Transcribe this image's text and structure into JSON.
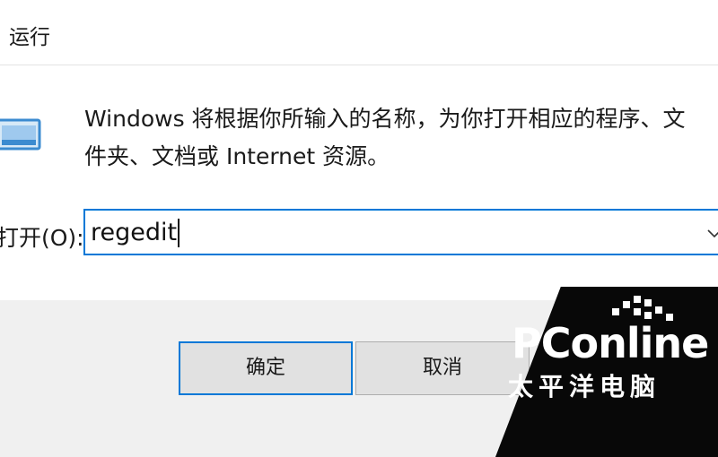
{
  "window": {
    "title": "运行"
  },
  "dialog": {
    "description_line1": "Windows 将根据你所输入的名称，为你打开相应的程序、文",
    "description_line2": "件夹、文档或 Internet 资源。",
    "open_label": "打开(O):",
    "input_value": "regedit",
    "icon": "run-dialog-icon"
  },
  "buttons": {
    "ok": "确定",
    "cancel": "取消"
  },
  "watermark": {
    "brand": "PConline",
    "sub": "太平洋电脑"
  },
  "colors": {
    "focus": "#0078d7",
    "footer_bg": "#f0f0f0",
    "button_bg": "#e1e1e1"
  }
}
